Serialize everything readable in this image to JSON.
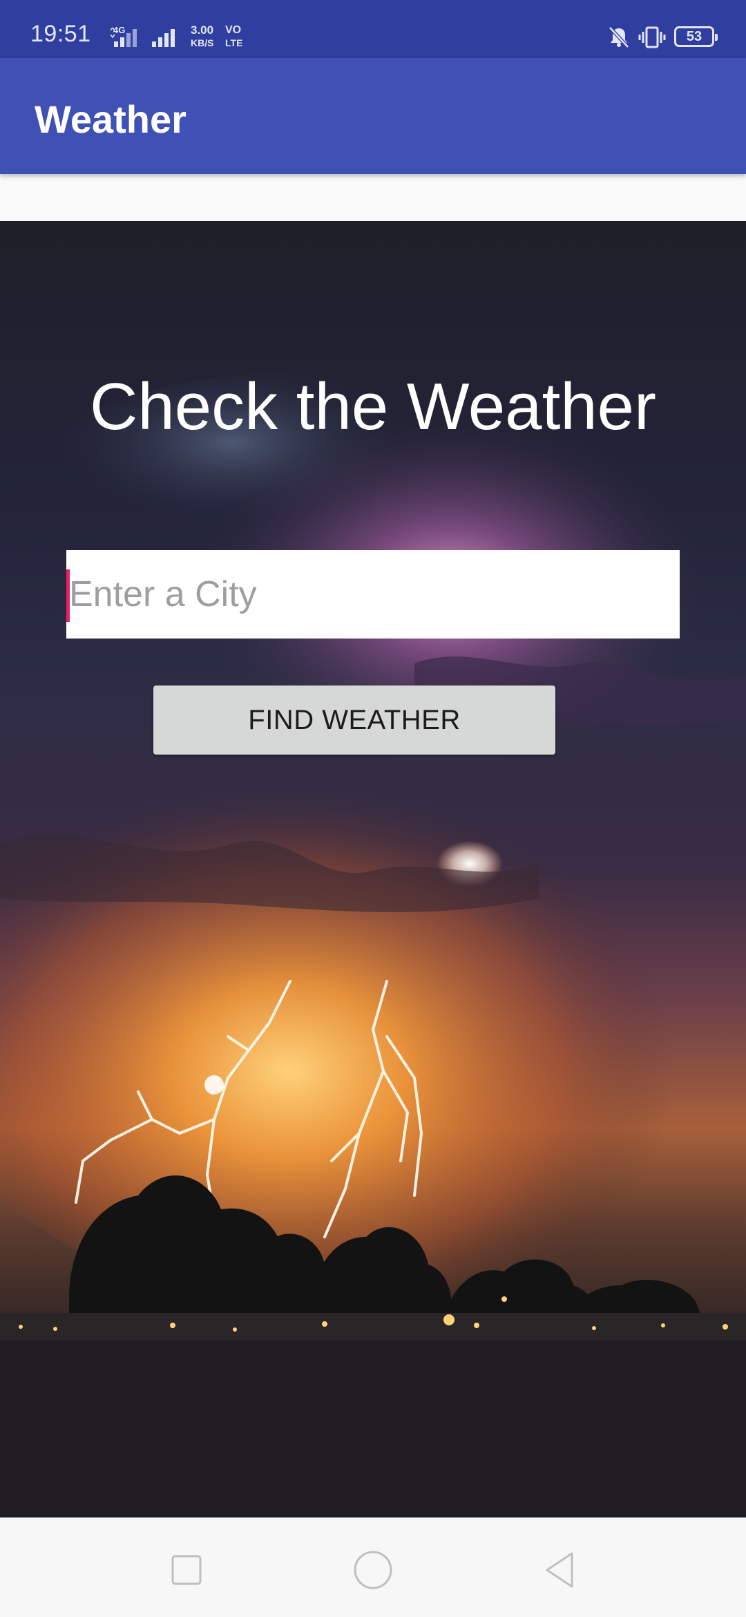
{
  "status_bar": {
    "time": "19:51",
    "network": "4G",
    "speed_value": "3.00",
    "speed_unit": "KB/S",
    "volte_top": "VO",
    "volte_bottom": "LTE",
    "battery": "53",
    "icons": [
      "signal-icon",
      "mute-icon",
      "vibrate-icon",
      "battery-icon"
    ]
  },
  "app_bar": {
    "title": "Weather"
  },
  "main": {
    "headline": "Check the Weather",
    "city_input": {
      "placeholder": "Enter a City",
      "value": ""
    },
    "find_button_label": "FIND WEATHER"
  },
  "nav_bar": {
    "icons": [
      "recents-icon",
      "home-icon",
      "back-icon"
    ]
  },
  "colors": {
    "status_bar": "#303f9f",
    "app_bar": "#3f51b5",
    "cursor_accent": "#e91e63",
    "button_bg": "#d6d7d7"
  }
}
